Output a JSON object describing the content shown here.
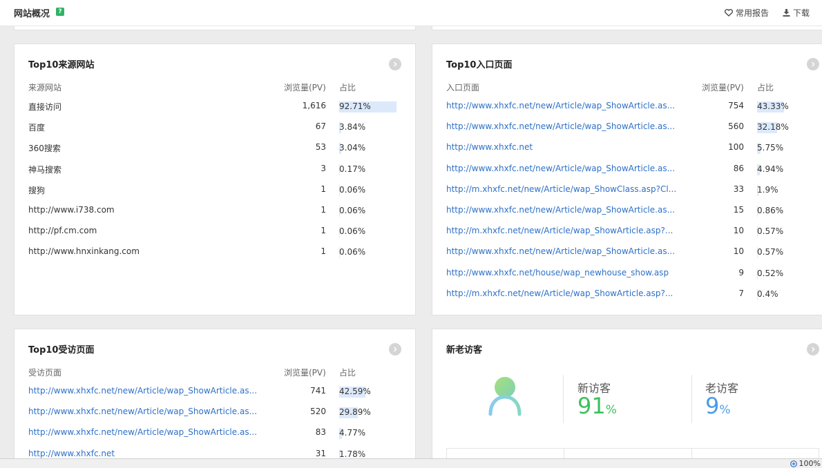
{
  "header": {
    "title": "网站概况",
    "help_badge": "?",
    "actions": [
      {
        "label": "常用报告",
        "icon": "heart-icon"
      },
      {
        "label": "下载",
        "icon": "download-icon"
      }
    ]
  },
  "sources": {
    "title": "Top10来源网站",
    "columns": [
      "来源网站",
      "浏览量(PV)",
      "占比"
    ],
    "rows": [
      {
        "name": "直接访问",
        "pv": "1,616",
        "pct": "92.71%",
        "share": 92.71
      },
      {
        "name": "百度",
        "pv": "67",
        "pct": "3.84%",
        "share": 3.84
      },
      {
        "name": "360搜索",
        "pv": "53",
        "pct": "3.04%",
        "share": 3.04
      },
      {
        "name": "神马搜索",
        "pv": "3",
        "pct": "0.17%",
        "share": 0.17
      },
      {
        "name": "搜狗",
        "pv": "1",
        "pct": "0.06%",
        "share": 0.06
      },
      {
        "name": "http://www.i738.com",
        "pv": "1",
        "pct": "0.06%",
        "share": 0.06
      },
      {
        "name": "http://pf.cm.com",
        "pv": "1",
        "pct": "0.06%",
        "share": 0.06
      },
      {
        "name": "http://www.hnxinkang.com",
        "pv": "1",
        "pct": "0.06%",
        "share": 0.06
      }
    ]
  },
  "entry_pages": {
    "title": "Top10入口页面",
    "columns": [
      "入口页面",
      "浏览量(PV)",
      "占比"
    ],
    "rows": [
      {
        "name": "http://www.xhxfc.net/new/Article/wap_ShowArticle.as...",
        "pv": "754",
        "pct": "43.33%",
        "share": 43.33
      },
      {
        "name": "http://www.xhxfc.net/new/Article/wap_ShowArticle.as...",
        "pv": "560",
        "pct": "32.18%",
        "share": 32.18
      },
      {
        "name": "http://www.xhxfc.net",
        "pv": "100",
        "pct": "5.75%",
        "share": 5.75
      },
      {
        "name": "http://www.xhxfc.net/new/Article/wap_ShowArticle.as...",
        "pv": "86",
        "pct": "4.94%",
        "share": 4.94
      },
      {
        "name": "http://m.xhxfc.net/new/Article/wap_ShowClass.asp?Cl...",
        "pv": "33",
        "pct": "1.9%",
        "share": 1.9
      },
      {
        "name": "http://www.xhxfc.net/new/Article/wap_ShowArticle.as...",
        "pv": "15",
        "pct": "0.86%",
        "share": 0.86
      },
      {
        "name": "http://m.xhxfc.net/new/Article/wap_ShowArticle.asp?...",
        "pv": "10",
        "pct": "0.57%",
        "share": 0.57
      },
      {
        "name": "http://www.xhxfc.net/new/Article/wap_ShowArticle.as...",
        "pv": "10",
        "pct": "0.57%",
        "share": 0.57
      },
      {
        "name": "http://www.xhxfc.net/house/wap_newhouse_show.asp",
        "pv": "9",
        "pct": "0.52%",
        "share": 0.52
      },
      {
        "name": "http://m.xhxfc.net/new/Article/wap_ShowArticle.asp?...",
        "pv": "7",
        "pct": "0.4%",
        "share": 0.4
      }
    ]
  },
  "visited_pages": {
    "title": "Top10受访页面",
    "columns": [
      "受访页面",
      "浏览量(PV)",
      "占比"
    ],
    "rows": [
      {
        "name": "http://www.xhxfc.net/new/Article/wap_ShowArticle.as...",
        "pv": "741",
        "pct": "42.59%",
        "share": 42.59
      },
      {
        "name": "http://www.xhxfc.net/new/Article/wap_ShowArticle.as...",
        "pv": "520",
        "pct": "29.89%",
        "share": 29.89
      },
      {
        "name": "http://www.xhxfc.net/new/Article/wap_ShowArticle.as...",
        "pv": "83",
        "pct": "4.77%",
        "share": 4.77
      },
      {
        "name": "http://www.xhxfc.net",
        "pv": "31",
        "pct": "1.78%",
        "share": 1.78
      }
    ]
  },
  "visitors": {
    "title": "新老访客",
    "new_label": "新访客",
    "new_value": "91",
    "old_label": "老访客",
    "old_value": "9",
    "pct_sign": "%",
    "new_color": "#3cbf5c",
    "old_color": "#4a9be8"
  },
  "status": {
    "zoom": "100%"
  }
}
